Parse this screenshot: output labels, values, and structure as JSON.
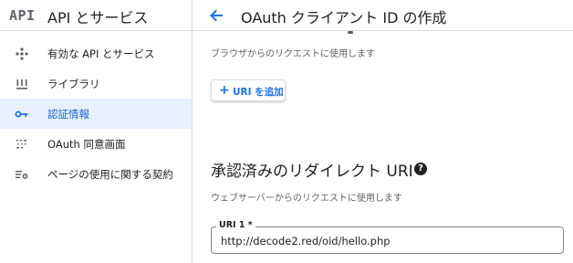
{
  "sidebar": {
    "logo": "API",
    "title": "API とサービス",
    "items": [
      {
        "label": "有効な API とサービス",
        "icon": "dashboard-diamond-icon",
        "active": false
      },
      {
        "label": "ライブラリ",
        "icon": "library-bars-icon",
        "active": false
      },
      {
        "label": "認証情報",
        "icon": "key-icon",
        "active": true
      },
      {
        "label": "OAuth 同意画面",
        "icon": "oauth-consent-icon",
        "active": false
      },
      {
        "label": "ページの使用に関する契約",
        "icon": "settings-list-icon",
        "active": false
      }
    ]
  },
  "header": {
    "title": "OAuth クライアント ID の作成"
  },
  "main": {
    "origins_hint": "ブラウザからのリクエストに使用します",
    "add_uri_button": "URI を追加",
    "redirect_section": {
      "title": "承認済みのリダイレクト URI",
      "hint": "ウェブサーバーからのリクエストに使用します",
      "field_label": "URI 1 *",
      "field_value": "http://decode2.red/oid/hello.php"
    }
  },
  "colors": {
    "accent": "#1a73e8",
    "active_bg": "#e8f0fe",
    "active_text": "#1967d2",
    "border": "#dadce0",
    "muted_text": "#5f6368"
  }
}
